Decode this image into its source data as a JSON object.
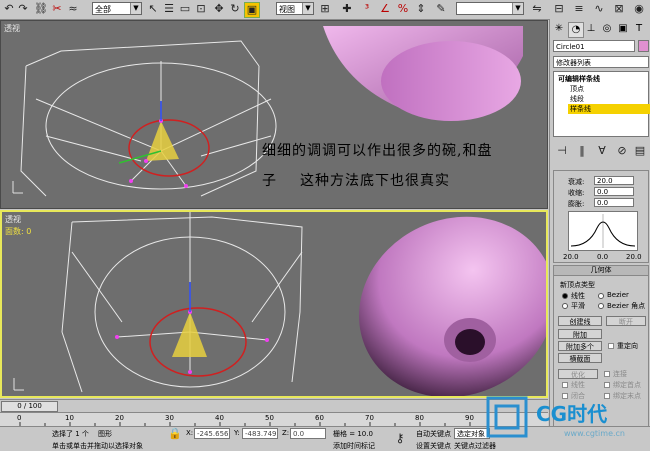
{
  "toolbar": {
    "selection_filter": "全部",
    "ref_coord": "视图",
    "named_selection": ""
  },
  "viewports": {
    "top": {
      "label": "透视"
    },
    "bottom": {
      "label": "透视",
      "sub": "面数: 0"
    }
  },
  "captions": {
    "line1": "细细的调调可以作出很多的碗,和盘",
    "line2_a": "子",
    "line2_b": "这种方法底下也很真实"
  },
  "timeline": {
    "frame": "0 / 100",
    "ticks": [
      "0",
      "10",
      "20",
      "30",
      "40",
      "50",
      "60",
      "70",
      "80",
      "90"
    ]
  },
  "status": {
    "selected": "选择了 1 个",
    "type": "图形",
    "prompt": "单击或单击并拖动以选择对象",
    "x_label": "X:",
    "x_value": "-245.656",
    "y_label": "Y:",
    "y_value": "-483.749",
    "z_label": "Z:",
    "z_value": "0.0",
    "grid": "栅格 = 10.0",
    "add_time_tag": "添加时间标记",
    "auto_key": "自动关键点",
    "set_key": "设置关键点",
    "key_filter": "关键点过滤器",
    "selected_obj": "选定对象"
  },
  "panel": {
    "object_name": "Circle01",
    "modifier_list": "修改器列表",
    "stack": [
      "可编辑样条线",
      "顶点",
      "线段",
      "样条线"
    ],
    "stack_selected_index": 3,
    "soft_selection": {
      "falloff_label": "衰减:",
      "falloff_value": "20.0",
      "pinch_label": "收缩:",
      "pinch_value": "0.0",
      "bubble_label": "膨胀:",
      "bubble_value": "0.0",
      "curve_left": "20.0",
      "curve_mid": "0.0",
      "curve_right": "20.0"
    },
    "geometry": {
      "title": "几何体",
      "new_vertex_type": "新顶点类型",
      "linear": "线性",
      "bezier": "Bezier",
      "smooth": "平滑",
      "bezier_corner": "Bezier 角点",
      "create_line": "创建线",
      "break": "断开",
      "attach": "附加",
      "attach_multiple": "附加多个",
      "reorient": "重定向",
      "cross_section": "横截面",
      "refine": "优化",
      "connect": "连接",
      "linear2": "线性",
      "bind_first": "绑定首点",
      "closed": "闭合",
      "bind_last": "绑定末点"
    }
  },
  "watermark": {
    "name": "CG时代",
    "url": "www.cgtime.cn"
  }
}
